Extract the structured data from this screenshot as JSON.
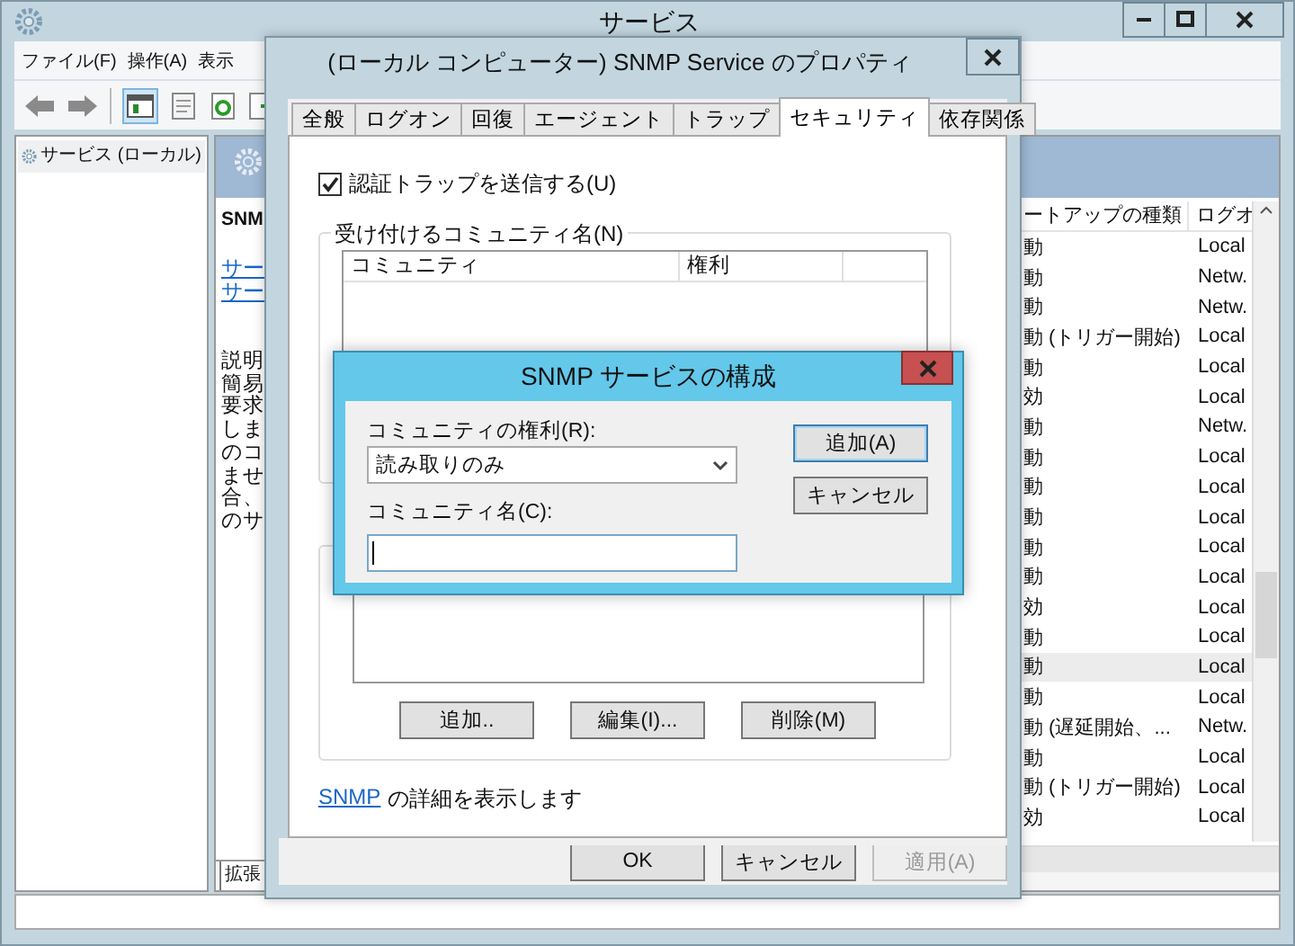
{
  "main_window": {
    "title": "サービス",
    "menu": [
      "ファイル(F)",
      "操作(A)",
      "表示"
    ],
    "tree": [
      {
        "label": "サービス (ローカル)"
      }
    ],
    "detail": {
      "title": "SNM",
      "links": [
        "サー",
        "サー"
      ],
      "description": [
        "説明",
        "簡易",
        "要求",
        "しま",
        "のコ",
        "ませ",
        "合、",
        "のサ"
      ],
      "tab": "拡張"
    },
    "list": {
      "columns": [
        "ートアップの種類",
        "ログオ"
      ],
      "rows": [
        {
          "startup": "動",
          "logon": "Local",
          "selected": false
        },
        {
          "startup": "動",
          "logon": "Netw.",
          "selected": false
        },
        {
          "startup": "動",
          "logon": "Netw.",
          "selected": false
        },
        {
          "startup": "動 (トリガー開始)",
          "logon": "Local",
          "selected": false
        },
        {
          "startup": "動",
          "logon": "Local",
          "selected": false
        },
        {
          "startup": "効",
          "logon": "Local",
          "selected": false
        },
        {
          "startup": "動",
          "logon": "Netw.",
          "selected": false
        },
        {
          "startup": "動",
          "logon": "Local",
          "selected": false
        },
        {
          "startup": "動",
          "logon": "Local",
          "selected": false
        },
        {
          "startup": "動",
          "logon": "Local",
          "selected": false
        },
        {
          "startup": "動",
          "logon": "Local",
          "selected": false
        },
        {
          "startup": "動",
          "logon": "Local",
          "selected": false
        },
        {
          "startup": "効",
          "logon": "Local",
          "selected": false
        },
        {
          "startup": "動",
          "logon": "Local",
          "selected": false
        },
        {
          "startup": "動",
          "logon": "Local",
          "selected": true
        },
        {
          "startup": "動",
          "logon": "Local",
          "selected": false
        },
        {
          "startup": "動 (遅延開始、...",
          "logon": "Netw.",
          "selected": false
        },
        {
          "startup": "動",
          "logon": "Local",
          "selected": false
        },
        {
          "startup": "動 (トリガー開始)",
          "logon": "Local",
          "selected": false
        },
        {
          "startup": "効",
          "logon": "Local",
          "selected": false
        }
      ]
    }
  },
  "properties_dialog": {
    "title": "(ローカル コンピューター) SNMP Service のプロパティ",
    "tabs": [
      {
        "label": "全般",
        "selected": false
      },
      {
        "label": "ログオン",
        "selected": false
      },
      {
        "label": "回復",
        "selected": false
      },
      {
        "label": "エージェント",
        "selected": false
      },
      {
        "label": "トラップ",
        "selected": false
      },
      {
        "label": "セキュリティ",
        "selected": true
      },
      {
        "label": "依存関係",
        "selected": false
      }
    ],
    "send_auth_trap": {
      "label": "認証トラップを送信する(U)",
      "checked": true
    },
    "communities": {
      "label": "受け付けるコミュニティ名(N)",
      "columns": [
        "コミュニティ",
        "権利"
      ]
    },
    "host_buttons": [
      "追加..",
      "編集(I)...",
      "削除(M)"
    ],
    "link": "SNMP",
    "link_text": "の詳細を表示します",
    "buttons": [
      {
        "label": "OK",
        "disabled": false
      },
      {
        "label": "キャンセル",
        "disabled": false
      },
      {
        "label": "適用(A)",
        "disabled": true
      }
    ]
  },
  "config_dialog": {
    "title": "SNMP サービスの構成",
    "rights": {
      "label": "コミュニティの権利(R):",
      "value": "読み取りのみ"
    },
    "name": {
      "label": "コミュニティ名(C):"
    },
    "buttons": [
      {
        "label": "追加(A)",
        "default": true
      },
      {
        "label": "キャンセル",
        "default": false
      }
    ]
  }
}
